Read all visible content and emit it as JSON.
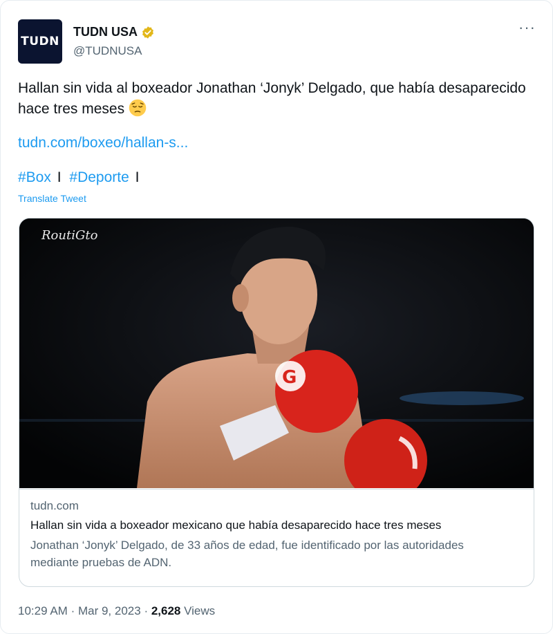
{
  "author": {
    "avatar_text": "TUDN",
    "name": "TUDN USA",
    "handle": "@TUDNUSA"
  },
  "more_icon": "···",
  "tweet": {
    "text": "Hallan sin vida al boxeador Jonathan ‘Jonyk’ Delgado, que había desaparecido hace tres meses",
    "link": "tudn.com/boxeo/hallan-s...",
    "hashtags": [
      "#Box",
      "#Deporte"
    ],
    "separator": "I",
    "translate_label": "Translate Tweet"
  },
  "card": {
    "watermark": "RoutiGto",
    "domain": "tudn.com",
    "title": "Hallan sin vida a boxeador mexicano que había desaparecido hace tres meses",
    "description": "Jonathan ‘Jonyk’ Delgado, de 33 años de edad, fue identificado por las autoridades mediante pruebas de ADN."
  },
  "meta": {
    "time": "10:29 AM",
    "dot": "·",
    "date": "Mar 9, 2023",
    "views_count": "2,628",
    "views_label": "Views"
  },
  "colors": {
    "link": "#1d9bf0",
    "verified_badge": "#e2b719",
    "text": "#0f1419",
    "muted": "#536471",
    "glove": "#d8241c"
  },
  "icons": {
    "verified": "verified-badge-icon",
    "emoji": "pensive-face-emoji",
    "more": "more-options-icon"
  }
}
